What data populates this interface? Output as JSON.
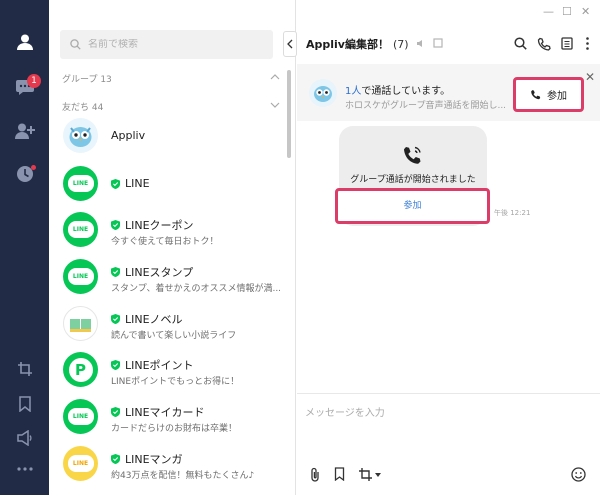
{
  "window": {
    "minimize_label": "—",
    "maximize_label": "☐",
    "close_label": "✕"
  },
  "rail": {
    "chat_badge": "1"
  },
  "search": {
    "placeholder": "名前で検索"
  },
  "sections": {
    "groups": "グループ 13",
    "friends": "友だち 44"
  },
  "friends": [
    {
      "name": "Appliv",
      "desc": "",
      "official": false,
      "avatar": "mascot"
    },
    {
      "name": "LINE",
      "desc": "",
      "official": true,
      "avatar": "LINE"
    },
    {
      "name": "LINEクーポン",
      "desc": "今すぐ使えて毎日おトク！",
      "official": true,
      "avatar": "LINE"
    },
    {
      "name": "LINEスタンプ",
      "desc": "スタンプ、着せかえのオススメ情報が満...",
      "official": true,
      "avatar": "LINE"
    },
    {
      "name": "LINEノベル",
      "desc": "読んで書いて楽しい小説ライフ",
      "official": true,
      "avatar": "novel"
    },
    {
      "name": "LINEポイント",
      "desc": "LINEポイントでもっとお得に！",
      "official": true,
      "avatar": "P"
    },
    {
      "name": "LINEマイカード",
      "desc": "カードだらけのお財布は卒業！",
      "official": true,
      "avatar": "LINE"
    },
    {
      "name": "LINEマンガ",
      "desc": "約43万点を配信！無料もたくさん♪",
      "official": true,
      "avatar": "manga"
    }
  ],
  "chat": {
    "title": "Appliv編集部！",
    "member_count": "(7)",
    "call_bar": {
      "count_text": "1人",
      "status_text": "で通話しています。",
      "detail_text": "ホロスケがグループ音声通話を開始し...",
      "join_label": "参加",
      "close_label": "✕"
    },
    "message": {
      "text": "グループ通話が開始されました",
      "join_label": "参加",
      "time": "午後 12:21"
    },
    "input": {
      "placeholder": "メッセージを入力"
    }
  },
  "colors": {
    "rail_bg": "#222b45",
    "line_green": "#06c755",
    "highlight": "#dc3d68",
    "link_blue": "#2a6fd6",
    "badge_red": "#e5394d"
  }
}
